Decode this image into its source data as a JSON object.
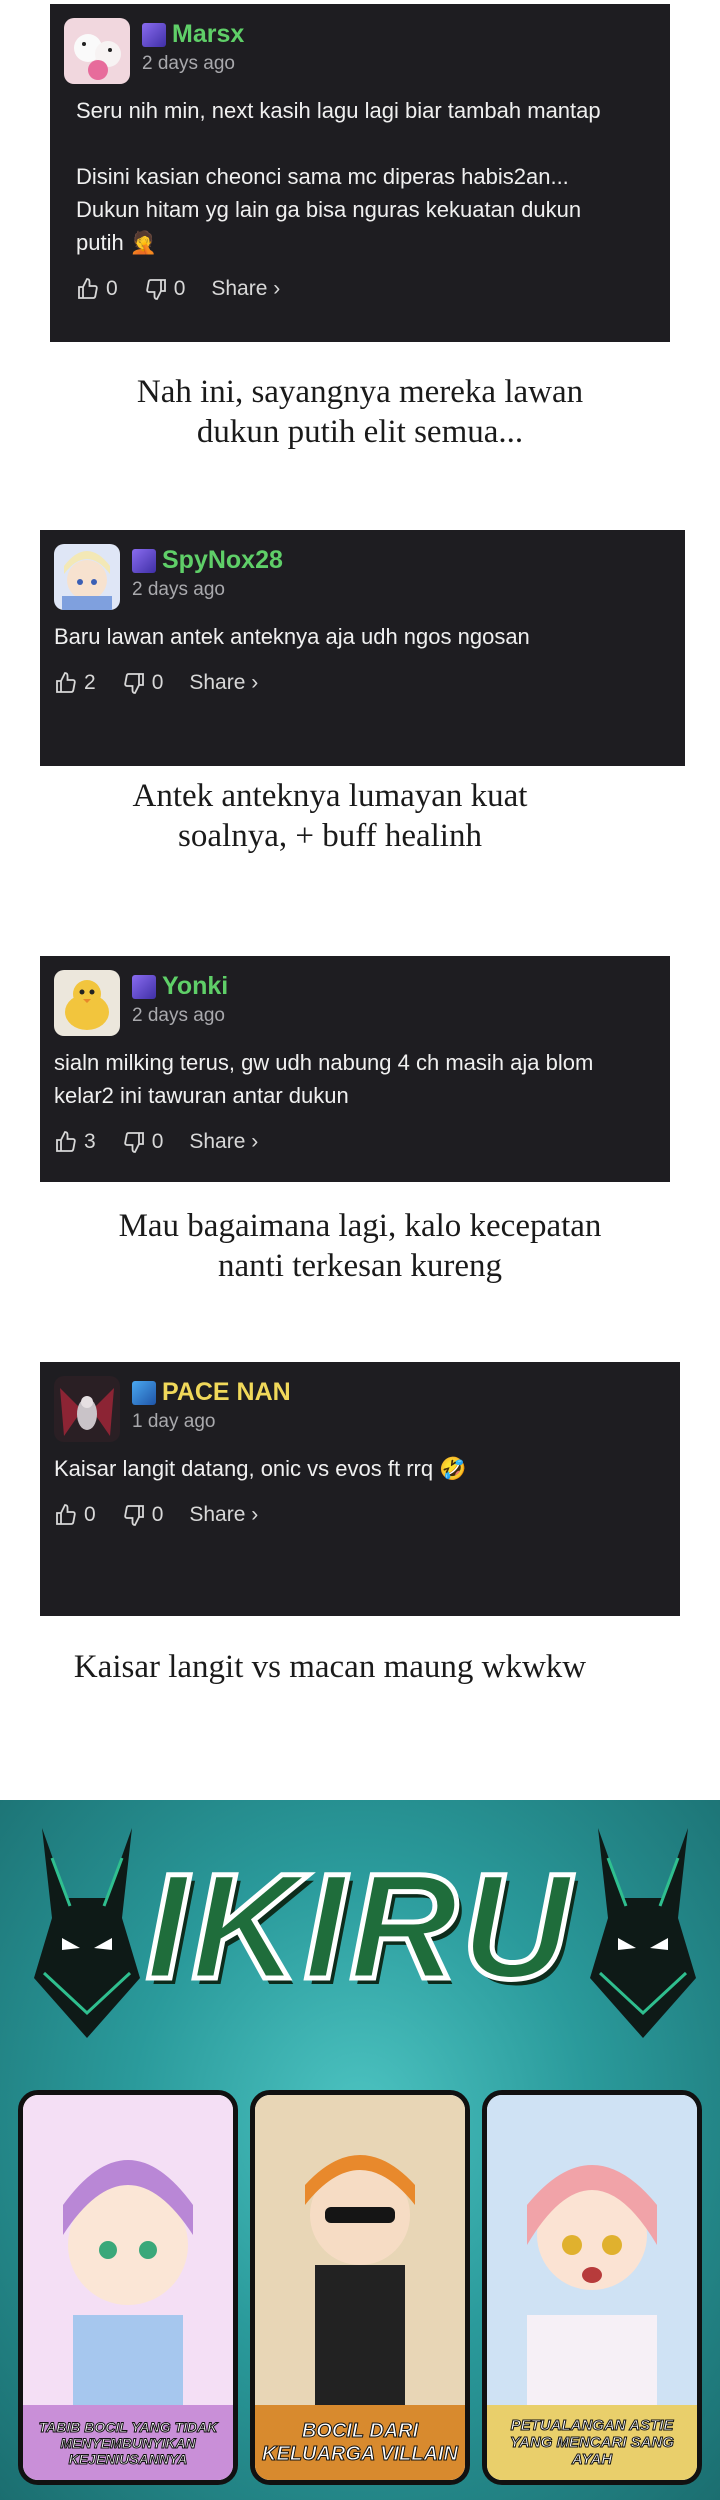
{
  "comments": [
    {
      "username": "Marsx",
      "time": "2 days ago",
      "text": "Seru nih min, next kasih lagu lagi biar tambah mantap\n\nDisini kasian cheonci sama mc diperas habis2an...\nDukun hitam yg lain ga bisa nguras kekuatan dukun\nputih 🤦",
      "likes": "0",
      "dislikes": "0",
      "share": "Share ›",
      "name_color": "#5fcf68"
    },
    {
      "username": "SpyNox28",
      "time": "2 days ago",
      "text": "Baru lawan antek anteknya aja udh ngos ngosan",
      "likes": "2",
      "dislikes": "0",
      "share": "Share ›",
      "name_color": "#5fcf68"
    },
    {
      "username": "Yonki",
      "time": "2 days ago",
      "text": "sialn milking terus, gw udh nabung 4 ch masih aja blom\nkelar2 ini tawuran antar dukun",
      "likes": "3",
      "dislikes": "0",
      "share": "Share ›",
      "name_color": "#5fcf68"
    },
    {
      "username": "PACE NAN",
      "time": "1 day ago",
      "text": "Kaisar langit datang, onic vs evos ft rrq 🤣",
      "likes": "0",
      "dislikes": "0",
      "share": "Share ›",
      "name_color": "#f0d85a"
    }
  ],
  "replies": [
    "Nah ini, sayangnya mereka lawan\ndukun putih elit semua...",
    "Antek anteknya lumayan kuat\nsoalnya, + buff healinh",
    "Mau bagaimana lagi, kalo kecepatan\nnanti terkesan kureng",
    "Kaisar langit vs macan maung wkwkw"
  ],
  "banner": {
    "title": "IKIRU",
    "panels": [
      {
        "caption": "Tabib bocil yang tidak menyembunyikan kejeniusannya",
        "caption_bg": "#c98fd8"
      },
      {
        "caption": "Bocil dari keluarga villain",
        "caption_bg": "#d88a2e"
      },
      {
        "caption": "Petualangan Astie yang mencari sang ayah",
        "caption_bg": "#e9cf6b"
      }
    ]
  },
  "icons": {
    "like": "thumbs-up-icon",
    "dislike": "thumbs-down-icon",
    "rank": "rank-badge-icon"
  }
}
